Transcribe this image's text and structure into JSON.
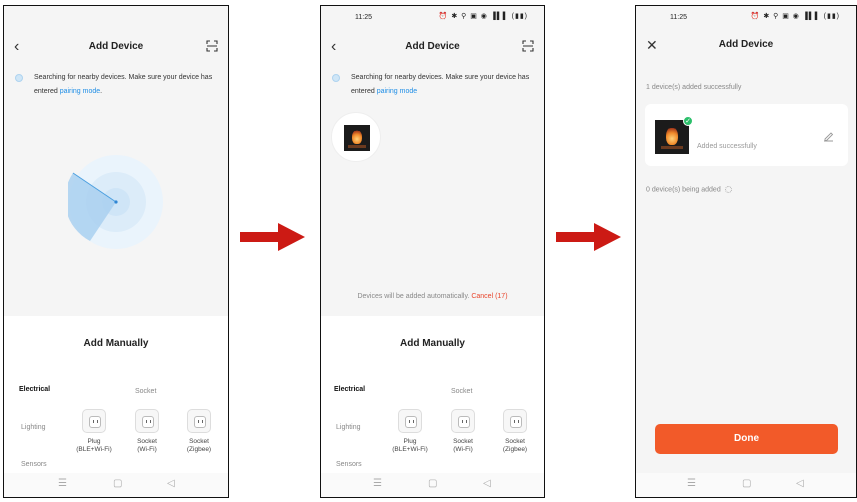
{
  "status_bar": {
    "time": "11:25",
    "icons": "⏰ ✱ ⚲ ▣ ◉ ▐▌▌ (▮▮)"
  },
  "screen1": {
    "title": "Add Device",
    "searching_text": "Searching for nearby devices. Make sure your device has entered ",
    "pairing_link": "pairing mode",
    "pairing_suffix": ".",
    "manual_title": "Add Manually",
    "categories": [
      "Electrical",
      "Lighting",
      "Sensors"
    ],
    "sub_heading": "Socket",
    "devices": [
      {
        "line1": "Plug",
        "line2": "(BLE+Wi-Fi)"
      },
      {
        "line1": "Socket",
        "line2": "(Wi-Fi)"
      },
      {
        "line1": "Socket",
        "line2": "(Zigbee)"
      }
    ]
  },
  "screen2": {
    "title": "Add Device",
    "searching_text": "Searching for nearby devices. Make sure your device has entered ",
    "pairing_link": "pairing mode",
    "auto_text": "Devices will be added automatically.",
    "cancel_text": "Cancel (17)",
    "manual_title": "Add Manually",
    "categories": [
      "Electrical",
      "Lighting",
      "Sensors"
    ],
    "sub_heading": "Socket",
    "devices": [
      {
        "line1": "Plug",
        "line2": "(BLE+Wi-Fi)"
      },
      {
        "line1": "Socket",
        "line2": "(Wi-Fi)"
      },
      {
        "line1": "Socket",
        "line2": "(Zigbee)"
      }
    ]
  },
  "screen3": {
    "title": "Add Device",
    "added_count_text": "1 device(s) added successfully",
    "device_status": "Added successfully",
    "being_added_text": "0 device(s) being added",
    "done_label": "Done"
  },
  "sysnav": {
    "menu": "☰",
    "home": "▢",
    "back": "◁"
  },
  "icons": {
    "back": "chevron-left-icon",
    "close": "close-icon",
    "scan": "scan-icon",
    "edit": "edit-pencil-icon",
    "check": "check-icon",
    "arrow": "right-arrow-icon"
  },
  "colors": {
    "accent_blue": "#1f8ee6",
    "cancel_red": "#e8452c",
    "done_orange": "#f25a29",
    "success_green": "#2bbf6a",
    "arrow_red": "#cc1a14"
  }
}
